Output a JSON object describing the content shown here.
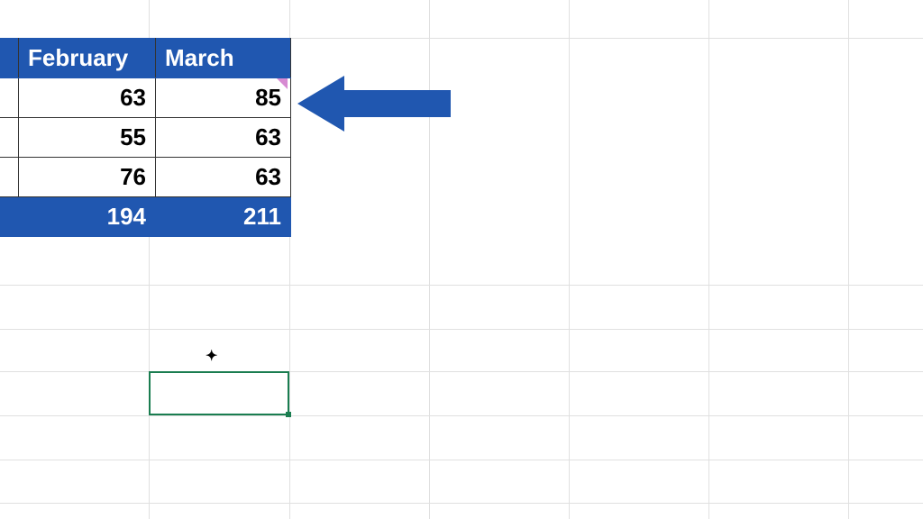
{
  "table": {
    "header": {
      "col1": "February",
      "col2": "March"
    },
    "rows": [
      {
        "feb": "63",
        "mar": "85"
      },
      {
        "feb": "55",
        "mar": "63"
      },
      {
        "feb": "76",
        "mar": "63"
      }
    ],
    "total": {
      "feb": "194",
      "mar": "211"
    }
  },
  "chart_data": {
    "type": "table",
    "columns": [
      "February",
      "March"
    ],
    "values": [
      [
        63,
        85
      ],
      [
        55,
        63
      ],
      [
        76,
        63
      ]
    ],
    "totals": [
      194,
      211
    ]
  }
}
